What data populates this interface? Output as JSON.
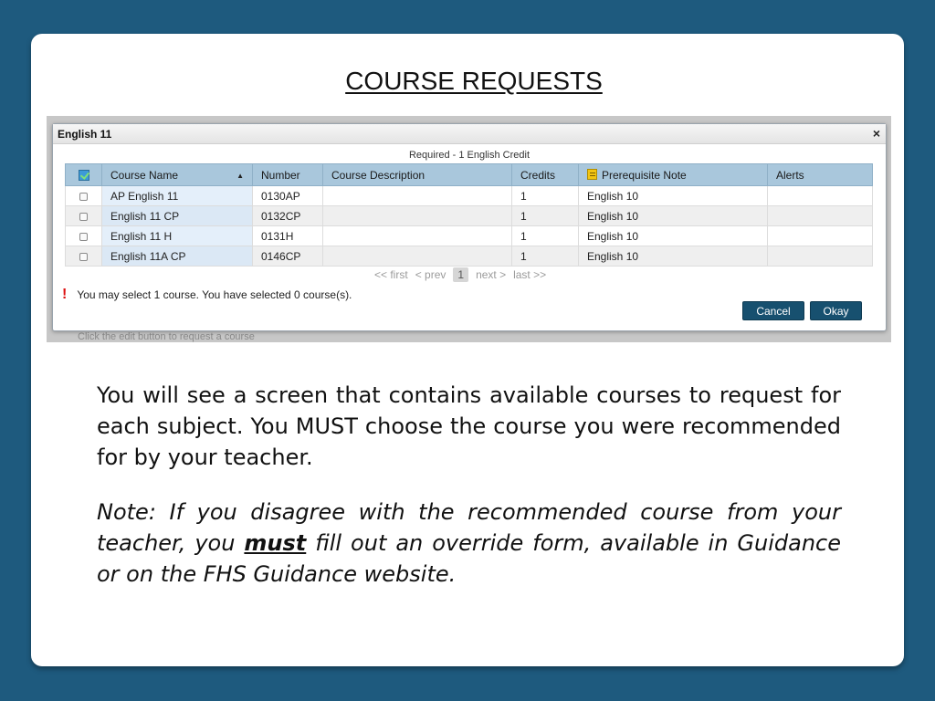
{
  "slide": {
    "title": "COURSE REQUESTS",
    "background_color": "#1e5a7e",
    "paragraph1": "You will see a screen that contains available courses to request for each subject.  You MUST choose the course you were recommended for by your teacher.",
    "paragraph2_before": "Note:  If you disagree with the recommended course from your teacher, you ",
    "paragraph2_emphasis": "must",
    "paragraph2_after": " fill out an override form, available in Guidance or on the FHS Guidance website."
  },
  "dialog": {
    "title": "English 11",
    "close_label": "×",
    "requirement": "Required - 1 English Credit",
    "background_hint": "Click the edit button to request a course",
    "columns": [
      "Course Name",
      "Number",
      "Course Description",
      "Credits",
      "Prerequisite Note",
      "Alerts"
    ],
    "rows": [
      {
        "name": "AP English 11",
        "number": "0130AP",
        "description": "",
        "credits": "1",
        "prereq": "English 10",
        "alerts": ""
      },
      {
        "name": "English 11 CP",
        "number": "0132CP",
        "description": "",
        "credits": "1",
        "prereq": "English 10",
        "alerts": ""
      },
      {
        "name": "English 11 H",
        "number": "0131H",
        "description": "",
        "credits": "1",
        "prereq": "English 10",
        "alerts": ""
      },
      {
        "name": "English 11A CP",
        "number": "0146CP",
        "description": "",
        "credits": "1",
        "prereq": "English 10",
        "alerts": ""
      }
    ],
    "pager": {
      "first": "<< first",
      "prev": "< prev",
      "page": "1",
      "next": "next >",
      "last": "last >>"
    },
    "warning_icon": "!",
    "warning": "You may select 1 course.  You have selected 0 course(s).",
    "cancel_label": "Cancel",
    "okay_label": "Okay",
    "header_color": "#a9c7dc",
    "button_color": "#17506f"
  }
}
